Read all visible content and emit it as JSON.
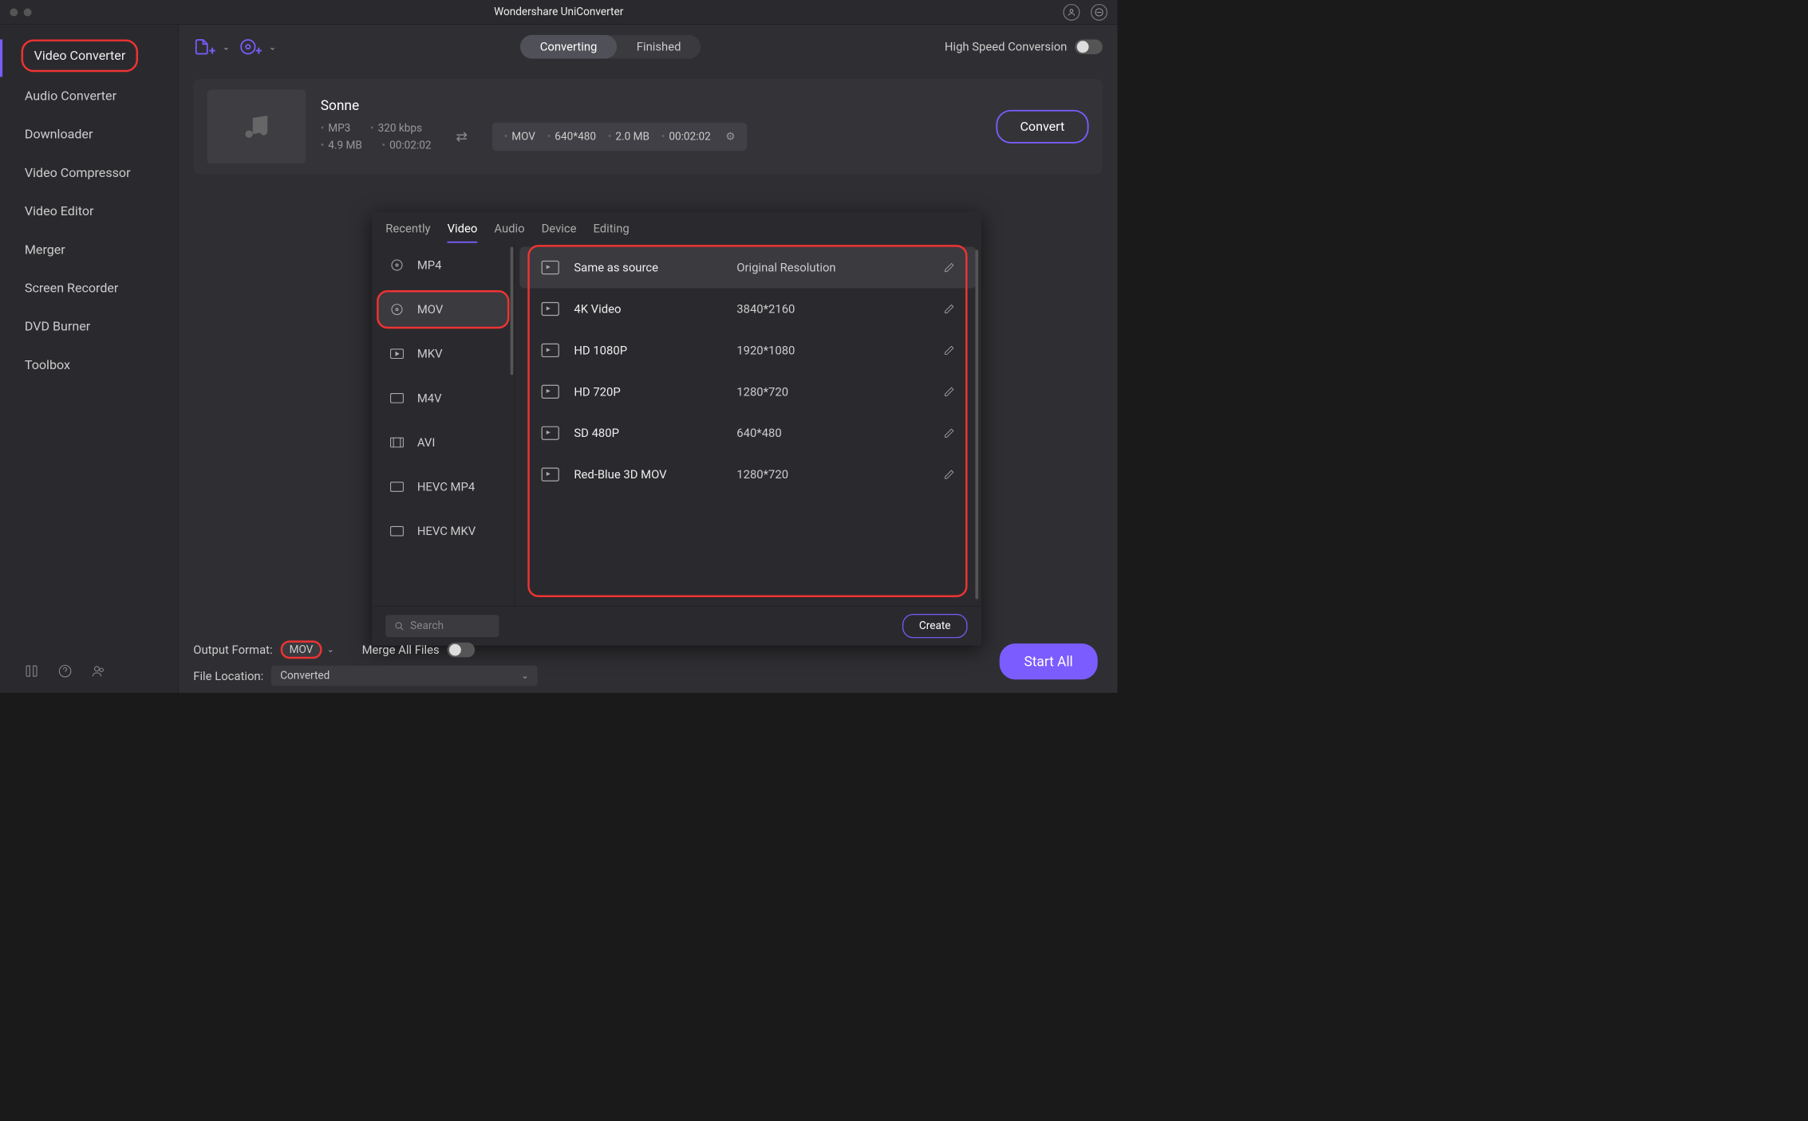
{
  "title": "Wondershare UniConverter",
  "sidebar": {
    "items": [
      "Video Converter",
      "Audio Converter",
      "Downloader",
      "Video Compressor",
      "Video Editor",
      "Merger",
      "Screen Recorder",
      "DVD Burner",
      "Toolbox"
    ]
  },
  "toolbar": {
    "segments": [
      "Converting",
      "Finished"
    ],
    "high_speed": "High Speed Conversion"
  },
  "file": {
    "name": "Sonne",
    "src": {
      "fmt": "MP3",
      "bitrate": "320 kbps",
      "size": "4.9 MB",
      "dur": "00:02:02"
    },
    "dst": {
      "fmt": "MOV",
      "res": "640*480",
      "size": "2.0 MB",
      "dur": "00:02:02"
    },
    "convert": "Convert"
  },
  "popover": {
    "tabs": [
      "Recently",
      "Video",
      "Audio",
      "Device",
      "Editing"
    ],
    "formats": [
      "MP4",
      "MOV",
      "MKV",
      "M4V",
      "AVI",
      "HEVC MP4",
      "HEVC MKV"
    ],
    "resolutions": [
      {
        "name": "Same as source",
        "size": "Original Resolution"
      },
      {
        "name": "4K Video",
        "size": "3840*2160"
      },
      {
        "name": "HD 1080P",
        "size": "1920*1080"
      },
      {
        "name": "HD 720P",
        "size": "1280*720"
      },
      {
        "name": "SD 480P",
        "size": "640*480"
      },
      {
        "name": "Red-Blue 3D MOV",
        "size": "1280*720"
      }
    ],
    "search": "Search",
    "create": "Create"
  },
  "bottom": {
    "output_label": "Output Format:",
    "output_value": "MOV",
    "merge": "Merge All Files",
    "location_label": "File Location:",
    "location_value": "Converted",
    "start": "Start All"
  }
}
